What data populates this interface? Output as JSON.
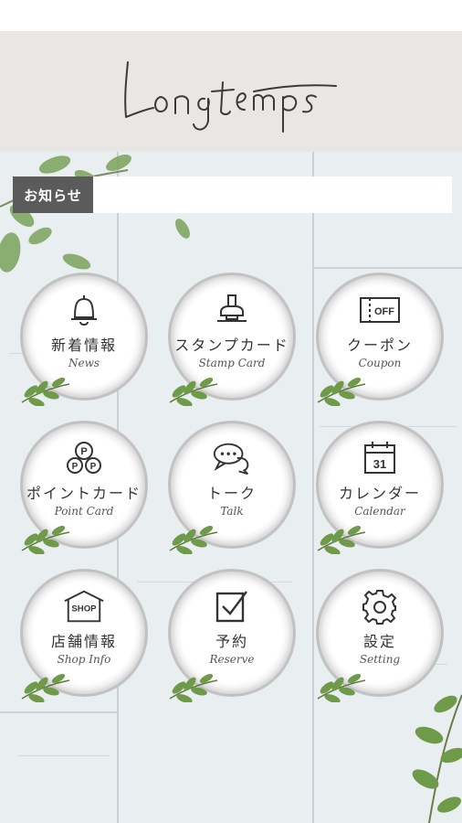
{
  "header": {
    "logo_text": "Longtemps"
  },
  "news": {
    "label": "お知らせ",
    "text": ""
  },
  "menu": [
    {
      "jp": "新着情報",
      "en": "News",
      "icon": "bell-icon"
    },
    {
      "jp": "スタンプカード",
      "en": "Stamp Card",
      "icon": "stamp-icon"
    },
    {
      "jp": "クーポン",
      "en": "Coupon",
      "icon": "coupon-icon"
    },
    {
      "jp": "ポイントカード",
      "en": "Point Card",
      "icon": "point-icon"
    },
    {
      "jp": "トーク",
      "en": "Talk",
      "icon": "chat-icon"
    },
    {
      "jp": "カレンダー",
      "en": "Calendar",
      "icon": "calendar-icon"
    },
    {
      "jp": "店舗情報",
      "en": "Shop Info",
      "icon": "shop-icon"
    },
    {
      "jp": "予約",
      "en": "Reserve",
      "icon": "reserve-icon"
    },
    {
      "jp": "設定",
      "en": "Setting",
      "icon": "gear-icon"
    }
  ],
  "icon_text": {
    "coupon": "OFF",
    "calendar": "31",
    "shop": "SHOP",
    "point": "P"
  },
  "colors": {
    "header_bg": "#e9e7e5",
    "news_label_bg": "#5b5b5b",
    "leaf": "#6f9a4a"
  }
}
